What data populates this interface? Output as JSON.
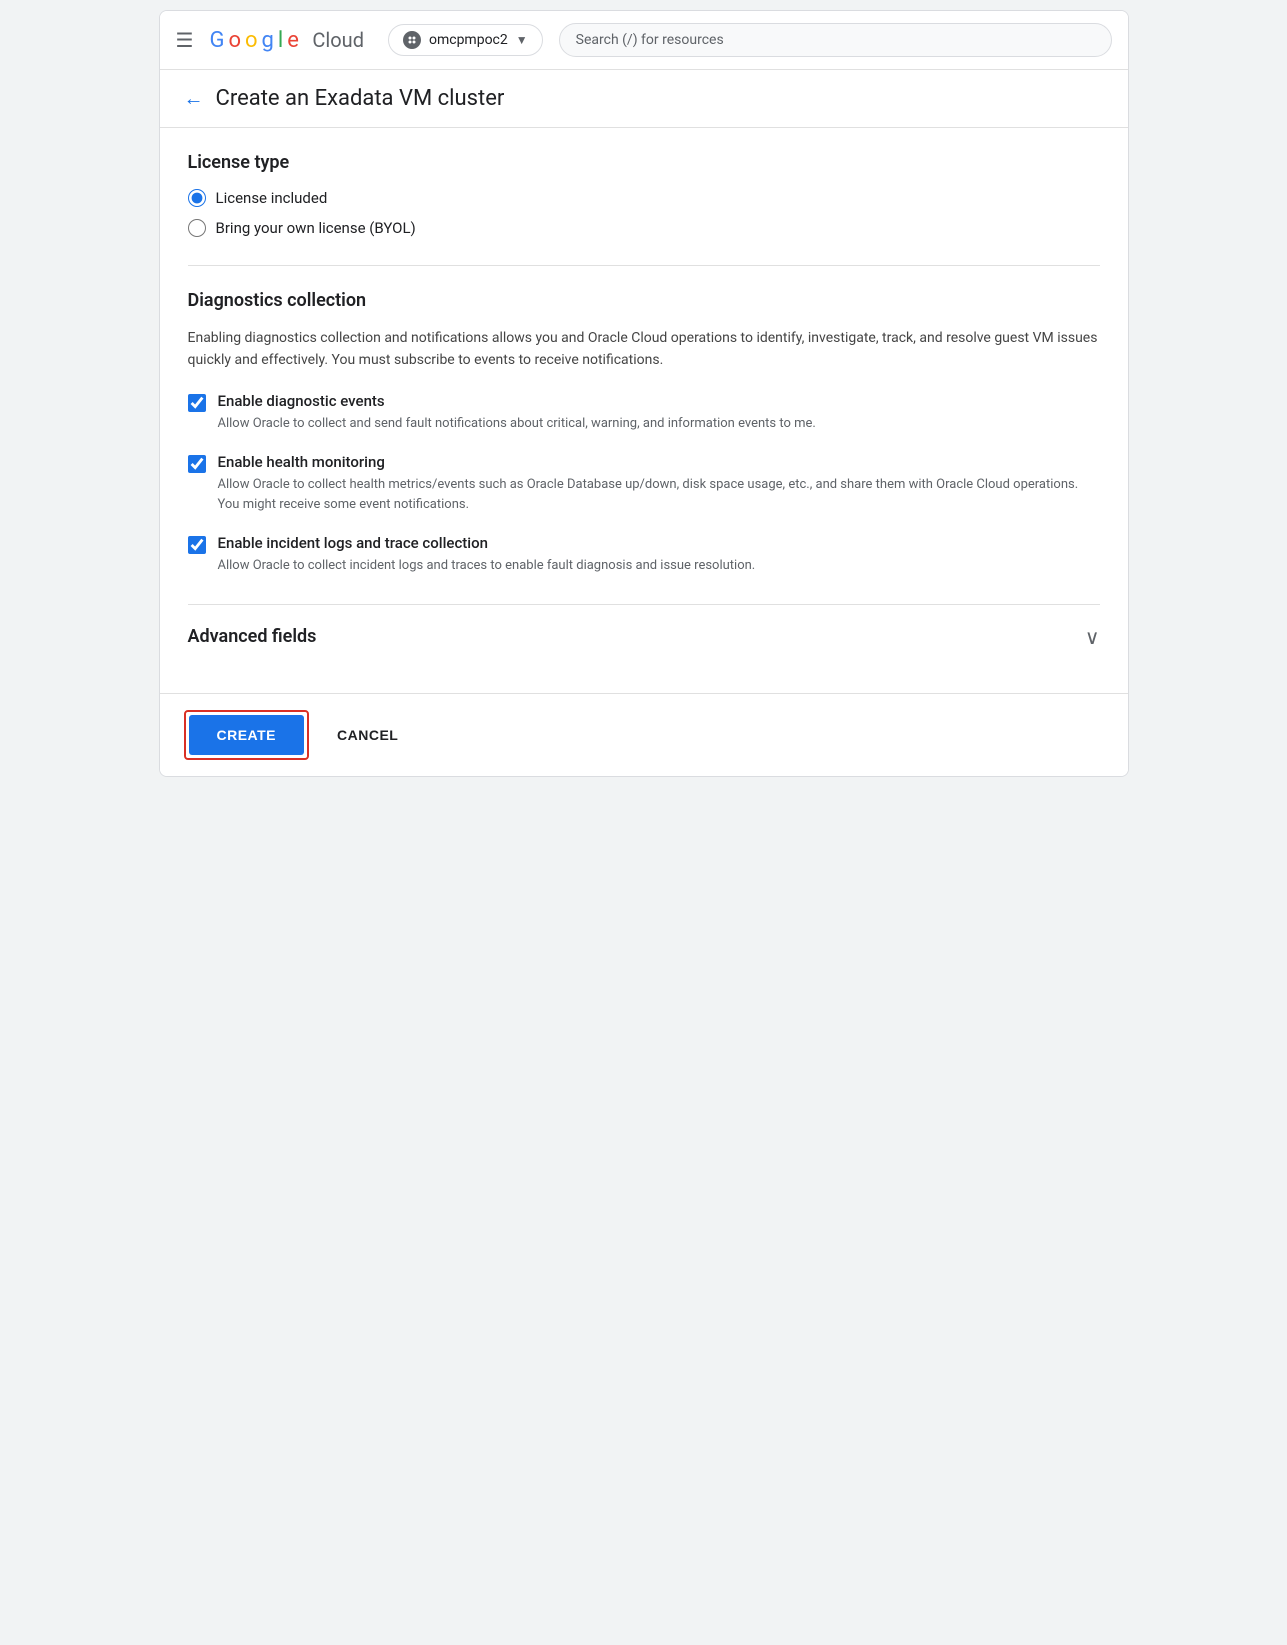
{
  "header": {
    "hamburger_label": "☰",
    "google_logo": "Google",
    "cloud_text": "Cloud",
    "project_name": "omcpmpoc2",
    "search_placeholder": "Search (/) for resources"
  },
  "page": {
    "back_label": "←",
    "title": "Create an Exadata VM cluster"
  },
  "license_type": {
    "section_title": "License type",
    "options": [
      {
        "id": "license-included",
        "label": "License included",
        "selected": true
      },
      {
        "id": "byol",
        "label": "Bring your own license (BYOL)",
        "selected": false
      }
    ]
  },
  "diagnostics": {
    "section_title": "Diagnostics collection",
    "description": "Enabling diagnostics collection and notifications allows you and Oracle Cloud operations to identify, investigate, track, and resolve guest VM issues quickly and effectively. You must subscribe to events to receive notifications.",
    "checkboxes": [
      {
        "id": "diagnostic-events",
        "label": "Enable diagnostic events",
        "description": "Allow Oracle to collect and send fault notifications about critical, warning, and information events to me.",
        "checked": true
      },
      {
        "id": "health-monitoring",
        "label": "Enable health monitoring",
        "description": "Allow Oracle to collect health metrics/events such as Oracle Database up/down, disk space usage, etc., and share them with Oracle Cloud operations. You might receive some event notifications.",
        "checked": true
      },
      {
        "id": "incident-logs",
        "label": "Enable incident logs and trace collection",
        "description": "Allow Oracle to collect incident logs and traces to enable fault diagnosis and issue resolution.",
        "checked": true
      }
    ]
  },
  "advanced_fields": {
    "title": "Advanced fields",
    "chevron": "∨"
  },
  "footer": {
    "create_label": "CREATE",
    "cancel_label": "CANCEL"
  }
}
